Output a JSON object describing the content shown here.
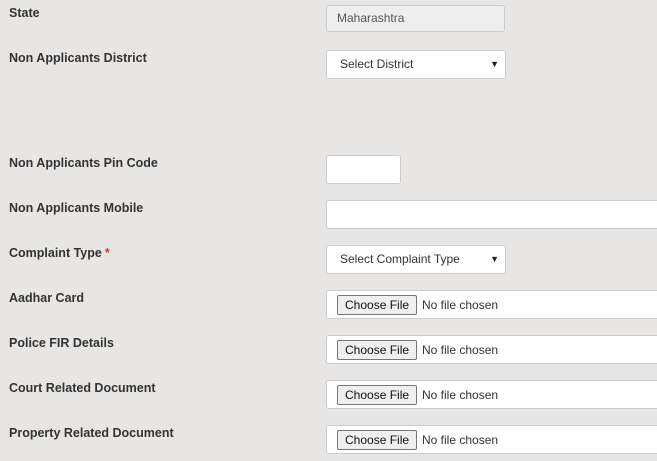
{
  "form": {
    "state": {
      "label": "State",
      "value": "Maharashtra"
    },
    "district": {
      "label": "Non Applicants District",
      "selected": "Select District"
    },
    "pin_code": {
      "label": "Non Applicants Pin Code",
      "value": ""
    },
    "mobile": {
      "label": "Non Applicants Mobile",
      "value": ""
    },
    "complaint_type": {
      "label": "Complaint Type",
      "required_mark": "*",
      "selected": "Select Complaint Type"
    },
    "file_button_label": "Choose File",
    "file_status_text": "No file chosen",
    "uploads": [
      {
        "label": "Aadhar Card"
      },
      {
        "label": "Police FIR Details"
      },
      {
        "label": "Court Related Document"
      },
      {
        "label": "Property Related Document"
      }
    ]
  }
}
